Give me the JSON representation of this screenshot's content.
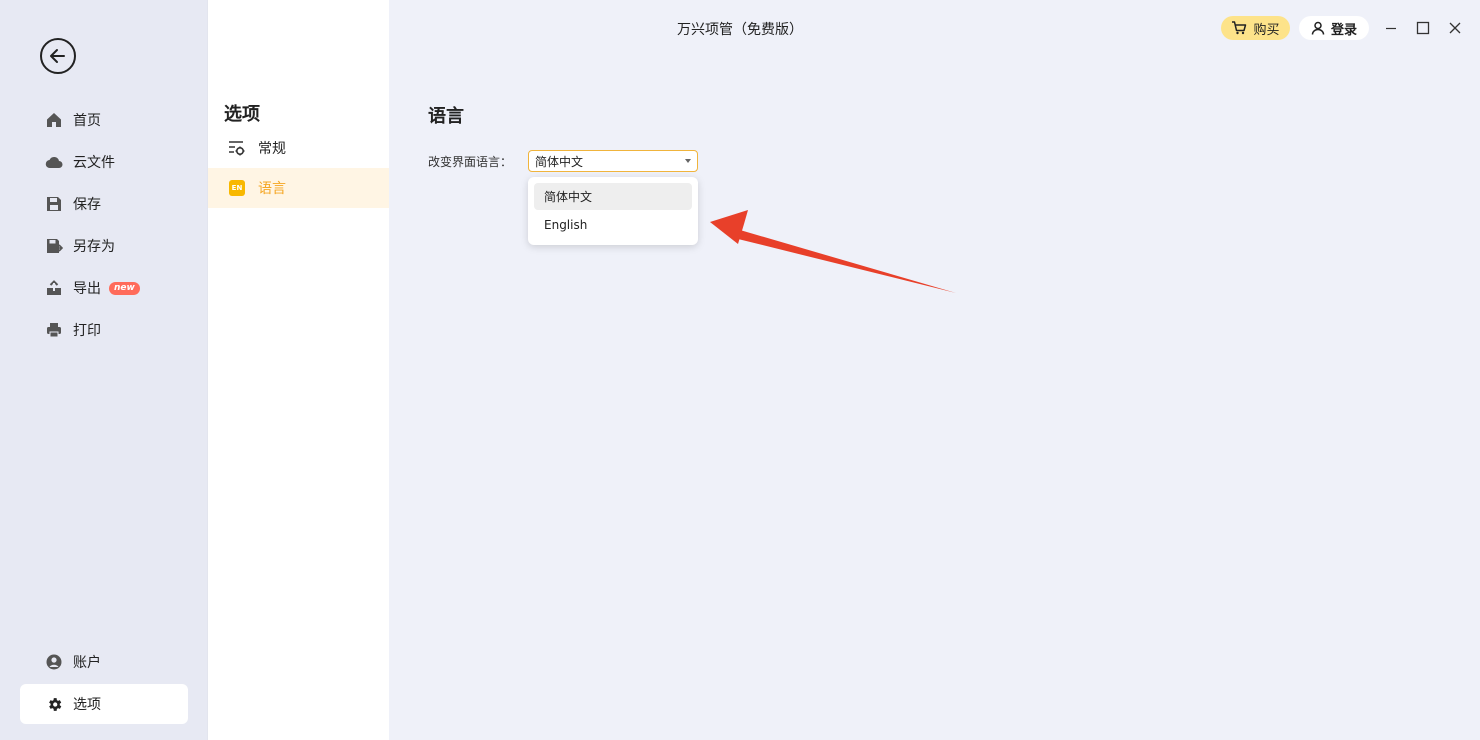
{
  "app": {
    "title": "万兴项管（免费版）"
  },
  "header": {
    "buy_label": "购买",
    "login_label": "登录"
  },
  "nav": {
    "items": [
      {
        "label": "首页",
        "icon": "home-icon"
      },
      {
        "label": "云文件",
        "icon": "cloud-icon"
      },
      {
        "label": "保存",
        "icon": "save-icon"
      },
      {
        "label": "另存为",
        "icon": "save-as-icon"
      },
      {
        "label": "导出",
        "icon": "export-icon",
        "badge": "new"
      },
      {
        "label": "打印",
        "icon": "print-icon"
      }
    ],
    "bottom_items": [
      {
        "label": "账户",
        "icon": "account-icon"
      },
      {
        "label": "选项",
        "icon": "gear-icon",
        "active": true
      }
    ]
  },
  "options": {
    "title": "选项",
    "items": [
      {
        "label": "常规",
        "icon": "settings-list-icon"
      },
      {
        "label": "语言",
        "icon": "language-icon",
        "icon_text": "EN",
        "active": true
      }
    ]
  },
  "language_panel": {
    "title": "语言",
    "field_label": "改变界面语言：",
    "selected": "简体中文",
    "options": [
      "简体中文",
      "English"
    ]
  },
  "colors": {
    "accent": "#f5a623",
    "buy_bg": "#fde38a",
    "arrow": "#e8402a"
  }
}
